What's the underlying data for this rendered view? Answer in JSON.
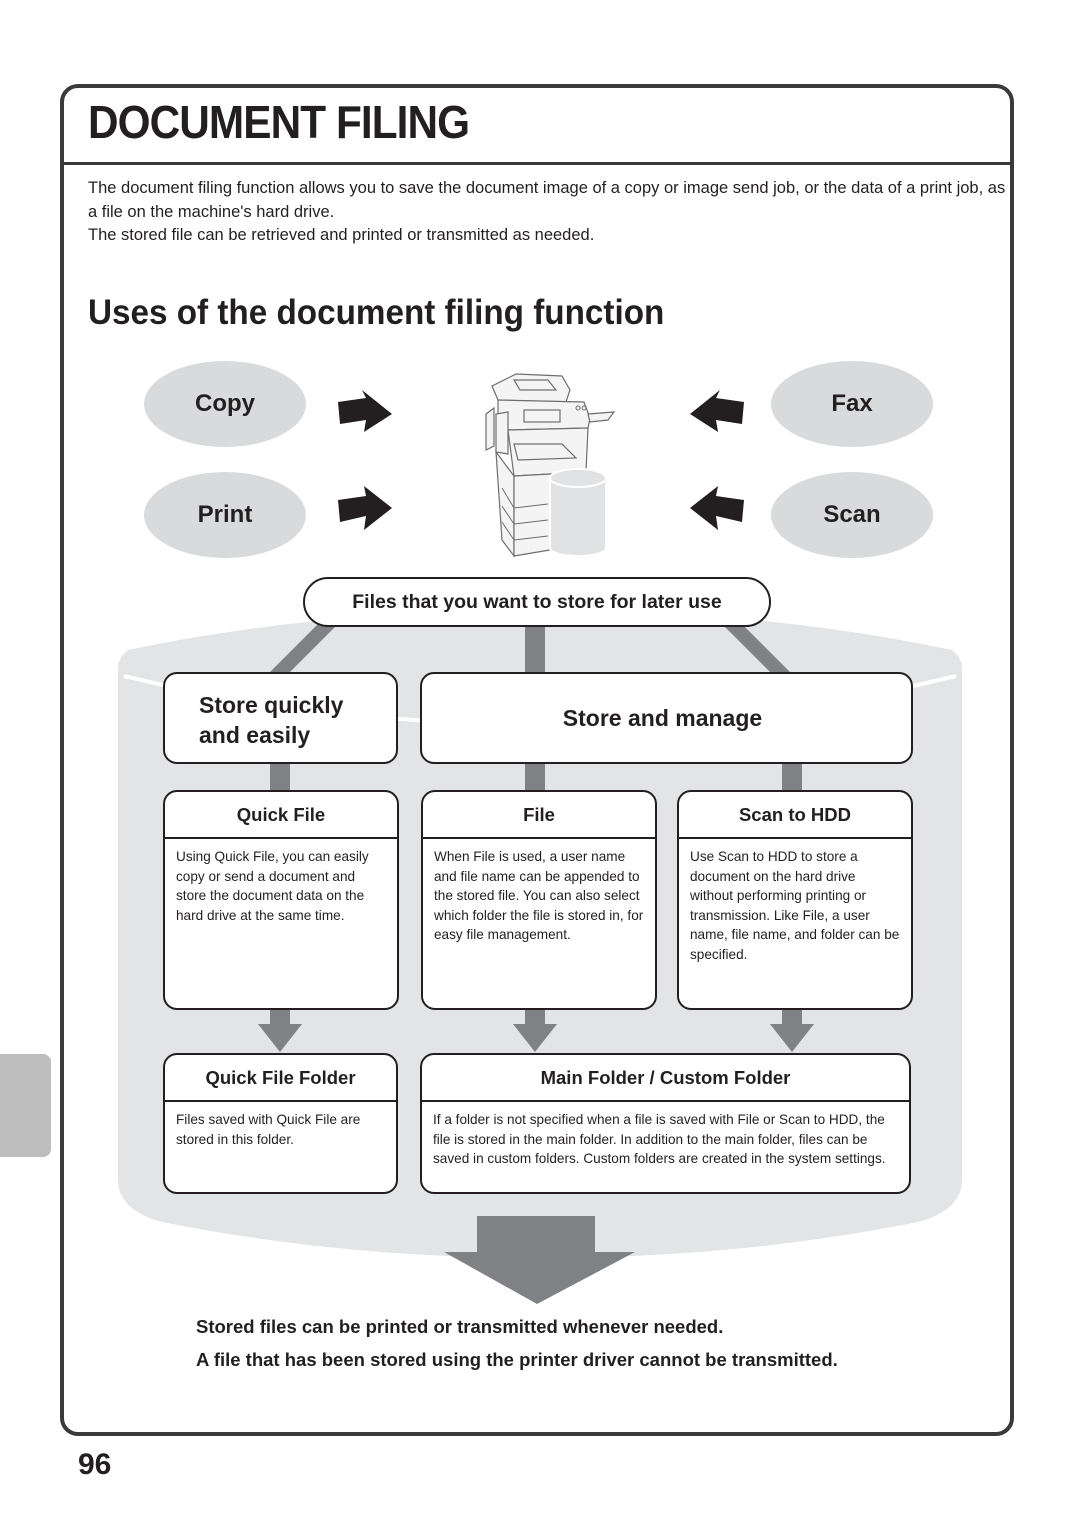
{
  "page": {
    "title": "DOCUMENT FILING",
    "intro_lines": [
      "The document filing function allows you to save the document image of a copy or image send job, or the data of a print job, as a file on the machine's hard drive.",
      "The stored file can be retrieved and printed or transmitted as needed."
    ],
    "section_title": "Uses of the document filing function",
    "page_number": "96"
  },
  "sources": {
    "left": [
      "Copy",
      "Print"
    ],
    "right": [
      "Fax",
      "Scan"
    ],
    "center_icon": "multifunction-printer-with-hard-drive"
  },
  "diagram": {
    "top_label": "Files that you want to store for later use",
    "categories": [
      {
        "label_line1": "Store quickly",
        "label_line2": "and easily"
      },
      {
        "label": "Store and manage"
      }
    ],
    "cards": [
      {
        "title": "Quick File",
        "body": "Using Quick File, you can easily copy or send a document and store the document data on the hard drive at the same time."
      },
      {
        "title": "File",
        "body": "When File is used, a user name and file name can be appended to the stored file. You can also select which folder the file is stored in, for easy file management."
      },
      {
        "title": "Scan to HDD",
        "body": "Use Scan to HDD to store a document on the hard drive without performing printing or transmission. Like File, a user name, file name, and folder can be specified."
      }
    ],
    "folders": [
      {
        "title": "Quick File Folder",
        "body": "Files saved with Quick File are stored in this folder."
      },
      {
        "title": "Main Folder / Custom Folder",
        "body": "If a folder is not specified when a file is saved with File or Scan to HDD, the file is stored in the main folder. In addition to the main folder, files can be saved in custom folders. Custom folders are created in the system settings."
      }
    ]
  },
  "notes": [
    "Stored files can be printed or transmitted whenever needed.",
    "A file that has been stored using the printer driver cannot be transmitted."
  ],
  "colors": {
    "text": "#231f20",
    "oval_fill": "#d9dadb",
    "tank_fill": "#e3e4e5",
    "connector": "#808184",
    "side_tab": "#bdbdbd"
  }
}
